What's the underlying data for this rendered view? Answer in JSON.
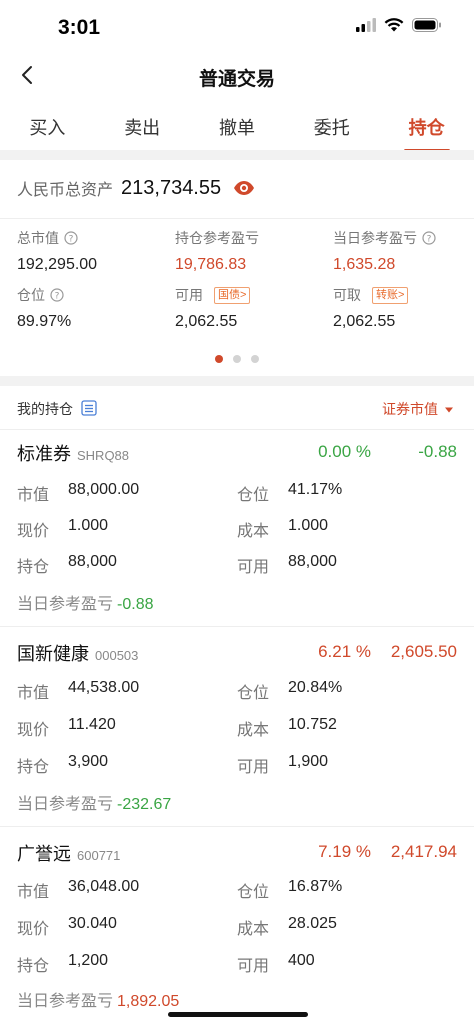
{
  "status": {
    "time": "3:01"
  },
  "nav": {
    "title": "普通交易"
  },
  "tabs": [
    {
      "label": "买入",
      "active": false
    },
    {
      "label": "卖出",
      "active": false
    },
    {
      "label": "撤单",
      "active": false
    },
    {
      "label": "委托",
      "active": false
    },
    {
      "label": "持仓",
      "active": true
    }
  ],
  "assets": {
    "total_label": "人民币总资产",
    "total_value": "213,734.55",
    "stats": {
      "market_value": {
        "label": "总市值",
        "value": "192,295.00"
      },
      "ref_pnl": {
        "label": "持仓参考盈亏",
        "value": "19,786.83"
      },
      "daily_pnl": {
        "label": "当日参考盈亏",
        "value": "1,635.28"
      },
      "position": {
        "label": "仓位",
        "value": "89.97%"
      },
      "available": {
        "label": "可用",
        "tag": "国债>",
        "value": "2,062.55"
      },
      "withdrawable": {
        "label": "可取",
        "tag": "转账>",
        "value": "2,062.55"
      }
    },
    "pager": {
      "count": 3,
      "active_index": 0
    }
  },
  "holdings": {
    "title": "我的持仓",
    "sort_label": "证券市值",
    "labels": {
      "market_value": "市值",
      "position": "仓位",
      "price": "现价",
      "cost": "成本",
      "shares": "持仓",
      "available": "可用",
      "daily_pnl": "当日参考盈亏"
    },
    "items": [
      {
        "name": "标准券",
        "code": "SHRQ88",
        "pct": "0.00 %",
        "pnl": "-0.88",
        "market_value": "88,000.00",
        "position": "41.17%",
        "price": "1.000",
        "cost": "1.000",
        "shares": "88,000",
        "available": "88,000",
        "daily_pnl": "-0.88"
      },
      {
        "name": "国新健康",
        "code": "000503",
        "pct": "6.21 %",
        "pnl": "2,605.50",
        "market_value": "44,538.00",
        "position": "20.84%",
        "price": "11.420",
        "cost": "10.752",
        "shares": "3,900",
        "available": "1,900",
        "daily_pnl": "-232.67"
      },
      {
        "name": "广誉远",
        "code": "600771",
        "pct": "7.19 %",
        "pnl": "2,417.94",
        "market_value": "36,048.00",
        "position": "16.87%",
        "price": "30.040",
        "cost": "28.025",
        "shares": "1,200",
        "available": "400",
        "daily_pnl": "1,892.05"
      }
    ]
  },
  "colors": {
    "accent": "#d0492b",
    "gain": "#d0492b",
    "loss": "#3aa544"
  }
}
